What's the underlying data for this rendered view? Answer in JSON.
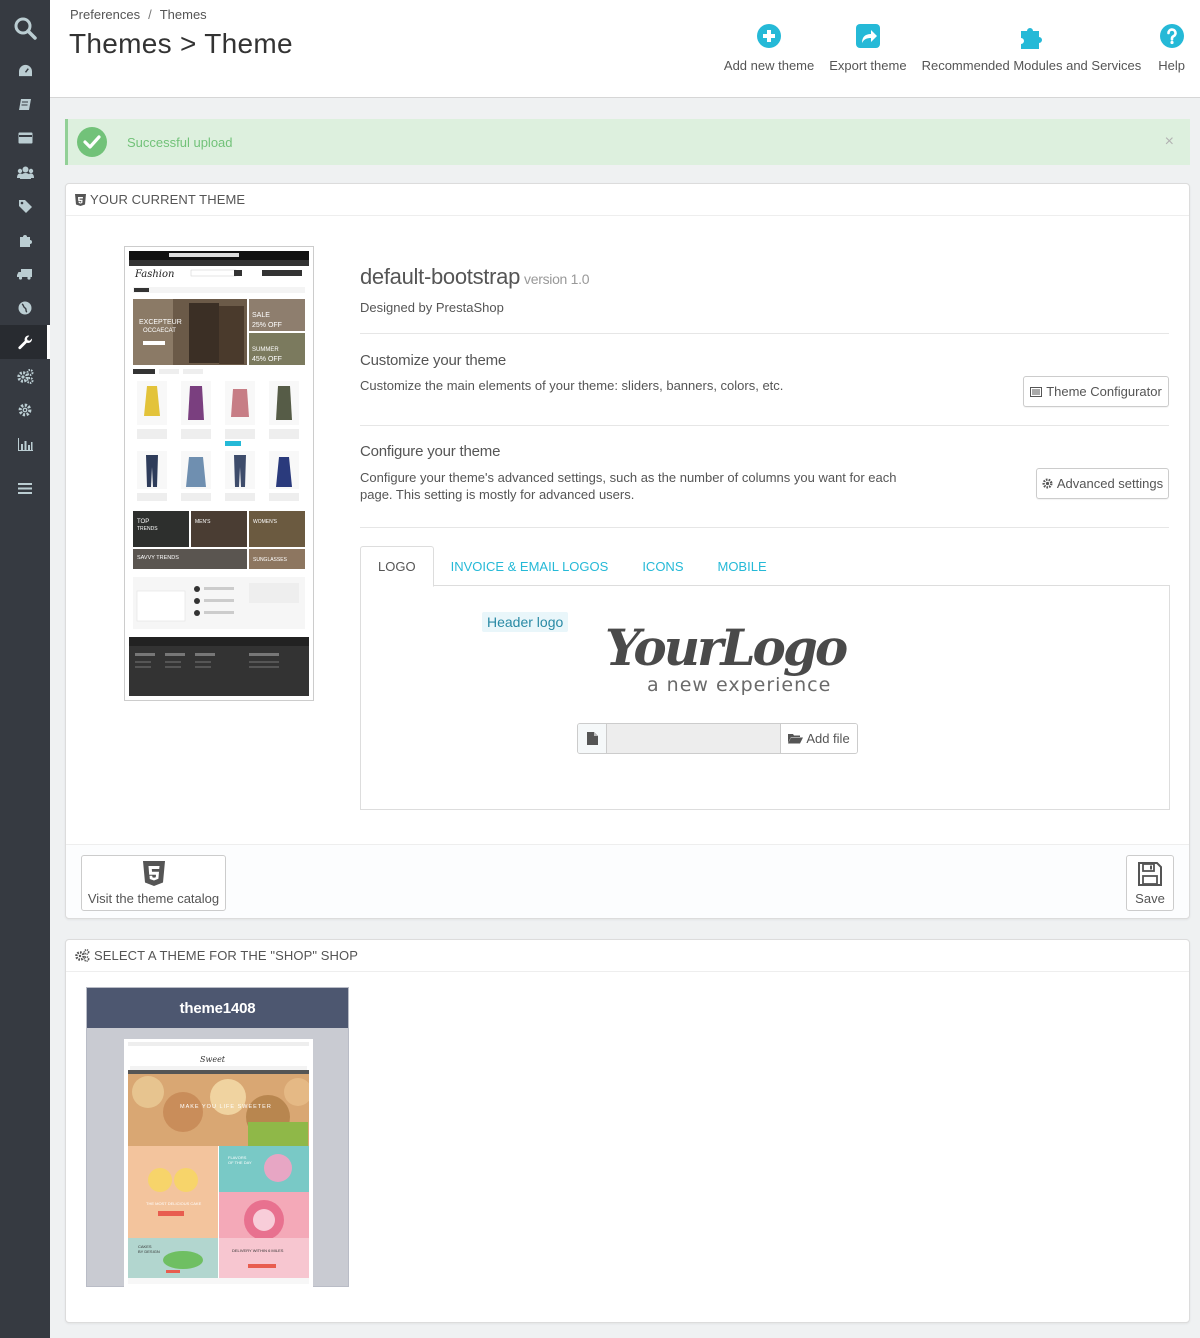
{
  "sidebar": {
    "items": [
      {
        "icon": "search-icon"
      },
      {
        "icon": "dashboard-icon"
      },
      {
        "icon": "orders-icon"
      },
      {
        "icon": "catalog-icon"
      },
      {
        "icon": "customers-icon"
      },
      {
        "icon": "price-rules-icon"
      },
      {
        "icon": "modules-icon"
      },
      {
        "icon": "shipping-icon"
      },
      {
        "icon": "localization-icon"
      },
      {
        "icon": "preferences-icon",
        "active": true
      },
      {
        "icon": "advanced-parameters-icon"
      },
      {
        "icon": "administration-icon"
      },
      {
        "icon": "stats-icon"
      },
      {
        "icon": "menu-collapse-icon"
      }
    ]
  },
  "breadcrumb": {
    "level1": "Preferences",
    "separator": "/",
    "level2": "Themes"
  },
  "page": {
    "title": "Themes > Theme"
  },
  "toolbar": {
    "add_new_theme": "Add new theme",
    "export_theme": "Export theme",
    "recommended": "Recommended Modules and Services",
    "help": "Help"
  },
  "alert": {
    "text": "Successful upload",
    "close": "×"
  },
  "current_theme": {
    "heading": "YOUR CURRENT THEME",
    "name": "default-bootstrap",
    "version": "version 1.0",
    "designed_by": "Designed by PrestaShop",
    "customize_title": "Customize your theme",
    "customize_text": "Customize the main elements of your theme: sliders, banners, colors, etc.",
    "theme_configurator_btn": "Theme Configurator",
    "configure_title": "Configure your theme",
    "configure_text": "Configure your theme's advanced settings, such as the number of columns you want for each page. This setting is mostly for advanced users.",
    "advanced_settings_btn": "Advanced settings",
    "tabs": [
      "LOGO",
      "INVOICE & EMAIL LOGOS",
      "ICONS",
      "MOBILE"
    ],
    "header_logo_label": "Header logo",
    "logo_text_main": "YourLogo",
    "logo_text_sub": "a new experience",
    "add_file_btn": "Add file",
    "catalog_btn": "Visit the theme catalog",
    "save_btn": "Save"
  },
  "select_theme": {
    "heading": "SELECT A THEME FOR THE \"SHOP\" SHOP",
    "themes": [
      {
        "name": "theme1408"
      }
    ]
  },
  "colors": {
    "sidebar_bg": "#363a41",
    "accent": "#25b9d7",
    "success": "#72c279",
    "theme_card_header": "#4d5770"
  }
}
